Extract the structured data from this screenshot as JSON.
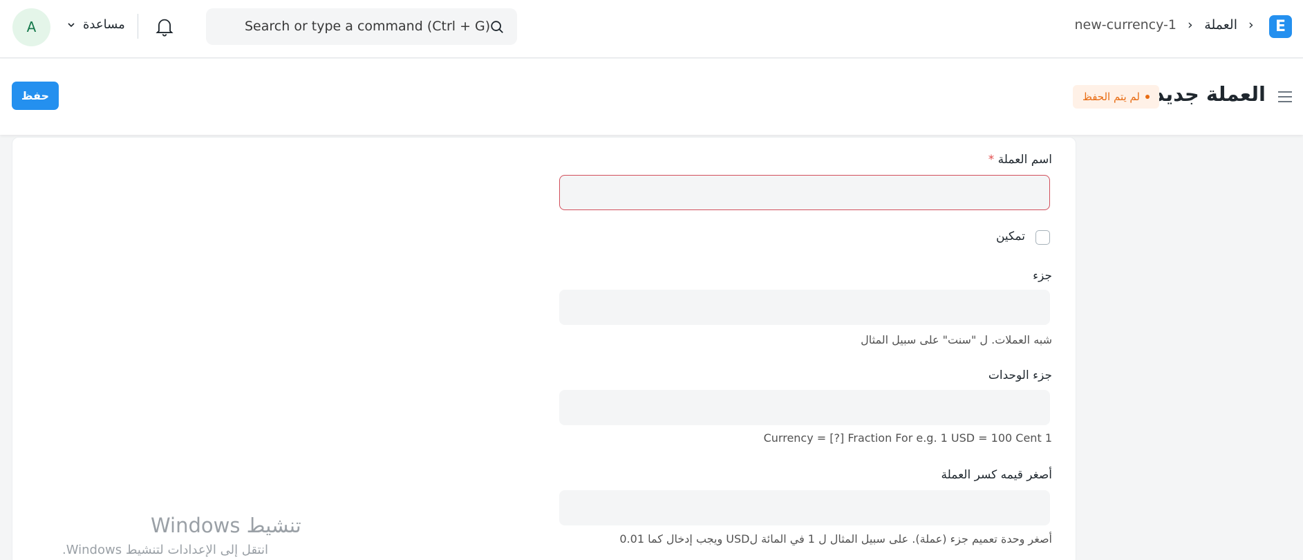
{
  "navbar": {
    "logo_letter": "E",
    "breadcrumbs": [
      "العملة",
      "new-currency-1"
    ],
    "search_placeholder": "Search or type a command (Ctrl + G)",
    "help_label": "مساعدة",
    "avatar_letter": "A"
  },
  "page_head": {
    "title": "العملة جديد",
    "status": "لم يتم الحفظ",
    "save_label": "حفظ"
  },
  "form": {
    "currency_name": {
      "label": "اسم العملة",
      "required_mark": "*",
      "value": ""
    },
    "enabled": {
      "label": "تمكين",
      "checked": false
    },
    "fraction": {
      "label": "جزء",
      "value": "",
      "description": "شبه العملات. ل \"سنت\" على سبيل المثال"
    },
    "fraction_units": {
      "label": "جزء الوحدات",
      "value": "",
      "description": "1 Currency = [?] Fraction For e.g. 1 USD = 100 Cent"
    },
    "smallest_fraction": {
      "label": "أصغر قيمه كسر العملة",
      "value": "",
      "description": "أصغر وحدة تعميم جزء (عملة). على سبيل المثال ل 1 في المائة لUSD ويجب إدخال كما 0.01"
    }
  },
  "watermark": {
    "title": "تنشيط Windows",
    "subtitle": "انتقل إلى الإعدادات لتنشيط Windows."
  },
  "colors": {
    "primary": "#2490ef",
    "status_text": "#e86c13",
    "status_bg": "#fff1e7",
    "invalid_border": "#d14e5a"
  }
}
